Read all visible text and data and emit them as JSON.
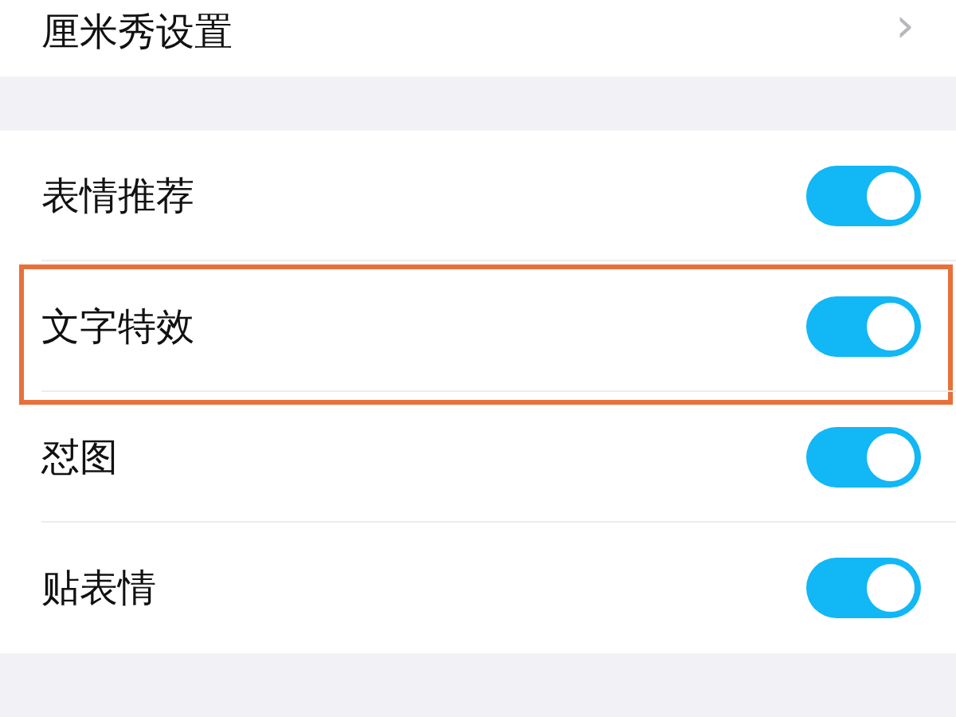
{
  "top_item": {
    "label": "厘米秀设置",
    "chevron": "›"
  },
  "toggles": [
    {
      "label": "表情推荐",
      "on": true,
      "highlighted": false
    },
    {
      "label": "文字特效",
      "on": true,
      "highlighted": true
    },
    {
      "label": "怼图",
      "on": true,
      "highlighted": false
    },
    {
      "label": "贴表情",
      "on": true,
      "highlighted": false
    }
  ]
}
